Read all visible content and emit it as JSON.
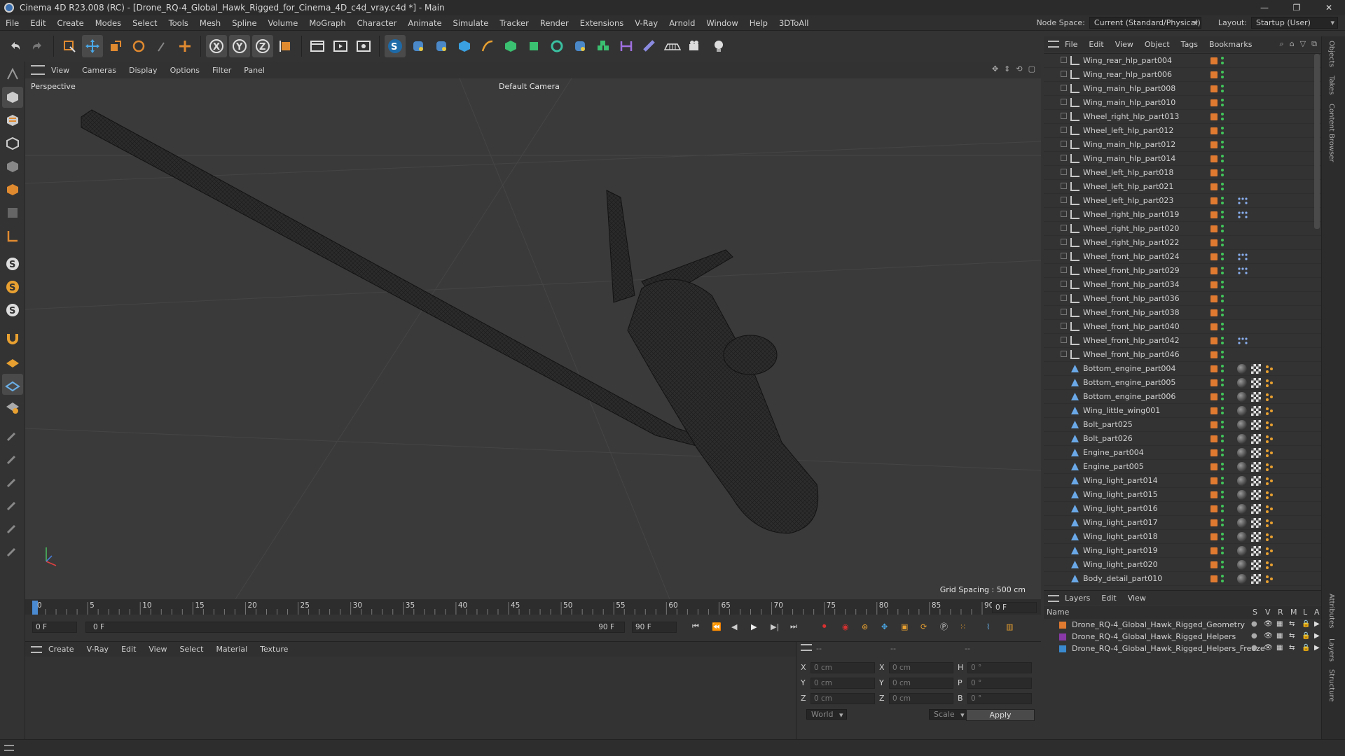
{
  "window": {
    "title": "Cinema 4D R23.008 (RC) - [Drone_RQ-4_Global_Hawk_Rigged_for_Cinema_4D_c4d_vray.c4d *] - Main",
    "min": "—",
    "max": "❐",
    "close": "✕"
  },
  "menu": [
    "File",
    "Edit",
    "Create",
    "Modes",
    "Select",
    "Tools",
    "Mesh",
    "Spline",
    "Volume",
    "MoGraph",
    "Character",
    "Animate",
    "Simulate",
    "Tracker",
    "Render",
    "Extensions",
    "V-Ray",
    "Arnold",
    "Window",
    "Help",
    "3DToAll"
  ],
  "node_space": {
    "label": "Node Space:",
    "value": "Current (Standard/Physical)"
  },
  "layout": {
    "label": "Layout:",
    "value": "Startup (User)"
  },
  "viewport": {
    "menu": [
      "View",
      "Cameras",
      "Display",
      "Options",
      "Filter",
      "Panel"
    ],
    "label": "Perspective",
    "camera": "Default Camera",
    "grid_spacing": "Grid Spacing : 500 cm"
  },
  "timeline": {
    "ticks": [
      "0",
      "5",
      "10",
      "15",
      "20",
      "25",
      "30",
      "35",
      "40",
      "45",
      "50",
      "55",
      "60",
      "65",
      "70",
      "75",
      "80",
      "85",
      "90"
    ],
    "current": "0 F",
    "start": "0 F",
    "end": "90 F",
    "end2": "90 F",
    "right_field": "0 F"
  },
  "material_menu": [
    "Create",
    "V-Ray",
    "Edit",
    "View",
    "Select",
    "Material",
    "Texture"
  ],
  "coords": {
    "rows": [
      {
        "a": "X",
        "av": "0 cm",
        "b": "X",
        "bv": "0 cm",
        "c": "H",
        "cv": "0 °"
      },
      {
        "a": "Y",
        "av": "0 cm",
        "b": "Y",
        "bv": "0 cm",
        "c": "P",
        "cv": "0 °"
      },
      {
        "a": "Z",
        "av": "0 cm",
        "b": "Z",
        "bv": "0 cm",
        "c": "B",
        "cv": "0 °"
      }
    ],
    "world": "World",
    "scale": "Scale",
    "apply": "Apply",
    "dash1": "--",
    "dash2": "--",
    "dash3": "--"
  },
  "objects_menu": [
    "File",
    "Edit",
    "View",
    "Object",
    "Tags",
    "Bookmarks"
  ],
  "objects": [
    {
      "name": "Wing_rear_hlp_part004",
      "type": "null"
    },
    {
      "name": "Wing_rear_hlp_part006",
      "type": "null"
    },
    {
      "name": "Wing_main_hlp_part008",
      "type": "null"
    },
    {
      "name": "Wing_main_hlp_part010",
      "type": "null"
    },
    {
      "name": "Wheel_right_hlp_part013",
      "type": "null"
    },
    {
      "name": "Wheel_left_hlp_part012",
      "type": "null"
    },
    {
      "name": "Wing_main_hlp_part012",
      "type": "null"
    },
    {
      "name": "Wing_main_hlp_part014",
      "type": "null"
    },
    {
      "name": "Wheel_left_hlp_part018",
      "type": "null"
    },
    {
      "name": "Wheel_left_hlp_part021",
      "type": "null"
    },
    {
      "name": "Wheel_left_hlp_part023",
      "type": "null",
      "extra": true
    },
    {
      "name": "Wheel_right_hlp_part019",
      "type": "null",
      "extra": true
    },
    {
      "name": "Wheel_right_hlp_part020",
      "type": "null"
    },
    {
      "name": "Wheel_right_hlp_part022",
      "type": "null"
    },
    {
      "name": "Wheel_front_hlp_part024",
      "type": "null",
      "extra": true
    },
    {
      "name": "Wheel_front_hlp_part029",
      "type": "null",
      "extra": true
    },
    {
      "name": "Wheel_front_hlp_part034",
      "type": "null"
    },
    {
      "name": "Wheel_front_hlp_part036",
      "type": "null"
    },
    {
      "name": "Wheel_front_hlp_part038",
      "type": "null"
    },
    {
      "name": "Wheel_front_hlp_part040",
      "type": "null"
    },
    {
      "name": "Wheel_front_hlp_part042",
      "type": "null",
      "extra": true
    },
    {
      "name": "Wheel_front_hlp_part046",
      "type": "null"
    },
    {
      "name": "Bottom_engine_part004",
      "type": "mesh"
    },
    {
      "name": "Bottom_engine_part005",
      "type": "mesh"
    },
    {
      "name": "Bottom_engine_part006",
      "type": "mesh"
    },
    {
      "name": "Wing_little_wing001",
      "type": "mesh"
    },
    {
      "name": "Bolt_part025",
      "type": "mesh"
    },
    {
      "name": "Bolt_part026",
      "type": "mesh"
    },
    {
      "name": "Engine_part004",
      "type": "mesh"
    },
    {
      "name": "Engine_part005",
      "type": "mesh"
    },
    {
      "name": "Wing_light_part014",
      "type": "mesh"
    },
    {
      "name": "Wing_light_part015",
      "type": "mesh"
    },
    {
      "name": "Wing_light_part016",
      "type": "mesh"
    },
    {
      "name": "Wing_light_part017",
      "type": "mesh"
    },
    {
      "name": "Wing_light_part018",
      "type": "mesh"
    },
    {
      "name": "Wing_light_part019",
      "type": "mesh"
    },
    {
      "name": "Wing_light_part020",
      "type": "mesh"
    },
    {
      "name": "Body_detail_part010",
      "type": "mesh"
    }
  ],
  "layers_menu": [
    "Layers",
    "Edit",
    "View"
  ],
  "layers_header": {
    "name": "Name",
    "cols": [
      "S",
      "V",
      "R",
      "M",
      "L",
      "A"
    ]
  },
  "layers": [
    {
      "name": "Drone_RQ-4_Global_Hawk_Rigged_Geometry",
      "color": "#e07a30"
    },
    {
      "name": "Drone_RQ-4_Global_Hawk_Rigged_Helpers",
      "color": "#8a3aa8"
    },
    {
      "name": "Drone_RQ-4_Global_Hawk_Rigged_Helpers_Freeze",
      "color": "#3a8ad0"
    }
  ],
  "side_tabs": [
    "Objects",
    "Takes",
    "Content Browser",
    "Attributes",
    "Layers",
    "Structure"
  ]
}
